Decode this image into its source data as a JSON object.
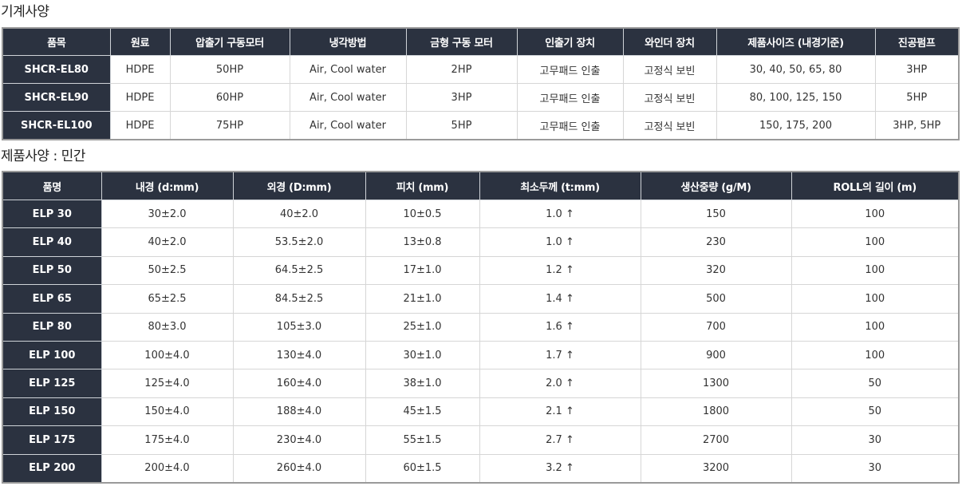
{
  "machine_spec": {
    "title": "기계사양",
    "headers": [
      "품목",
      "원료",
      "압출기 구동모터",
      "냉각방법",
      "금형 구동 모터",
      "인출기 장치",
      "와인더 장치",
      "제품사이즈 (내경기준)",
      "진공펌프"
    ],
    "rows": [
      [
        "SHCR-EL80",
        "HDPE",
        "50HP",
        "Air, Cool water",
        "2HP",
        "고무패드 인출",
        "고정식 보빈",
        "30, 40, 50, 65, 80",
        "3HP"
      ],
      [
        "SHCR-EL90",
        "HDPE",
        "60HP",
        "Air, Cool water",
        "3HP",
        "고무패드 인출",
        "고정식 보빈",
        "80, 100, 125, 150",
        "5HP"
      ],
      [
        "SHCR-EL100",
        "HDPE",
        "75HP",
        "Air, Cool water",
        "5HP",
        "고무패드 인출",
        "고정식 보빈",
        "150, 175, 200",
        "3HP, 5HP"
      ]
    ]
  },
  "product_spec": {
    "title": "제품사양 : 민간",
    "headers": [
      "품명",
      "내경 (d:mm)",
      "외경 (D:mm)",
      "피치 (mm)",
      "최소두께 (t:mm)",
      "생산중량 (g/M)",
      "ROLL의 길이 (m)"
    ],
    "rows": [
      [
        "ELP 30",
        "30±2.0",
        "40±2.0",
        "10±0.5",
        "1.0 ↑",
        "150",
        "100"
      ],
      [
        "ELP 40",
        "40±2.0",
        "53.5±2.0",
        "13±0.8",
        "1.0 ↑",
        "230",
        "100"
      ],
      [
        "ELP 50",
        "50±2.5",
        "64.5±2.5",
        "17±1.0",
        "1.2 ↑",
        "320",
        "100"
      ],
      [
        "ELP 65",
        "65±2.5",
        "84.5±2.5",
        "21±1.0",
        "1.4 ↑",
        "500",
        "100"
      ],
      [
        "ELP 80",
        "80±3.0",
        "105±3.0",
        "25±1.0",
        "1.6 ↑",
        "700",
        "100"
      ],
      [
        "ELP 100",
        "100±4.0",
        "130±4.0",
        "30±1.0",
        "1.7 ↑",
        "900",
        "100"
      ],
      [
        "ELP 125",
        "125±4.0",
        "160±4.0",
        "38±1.0",
        "2.0 ↑",
        "1300",
        "50"
      ],
      [
        "ELP 150",
        "150±4.0",
        "188±4.0",
        "45±1.5",
        "2.1 ↑",
        "1800",
        "50"
      ],
      [
        "ELP 175",
        "175±4.0",
        "230±4.0",
        "55±1.5",
        "2.7 ↑",
        "2700",
        "30"
      ],
      [
        "ELP 200",
        "200±4.0",
        "260±4.0",
        "60±1.5",
        "3.2 ↑",
        "3200",
        "30"
      ]
    ]
  },
  "colors": {
    "header_bg": "#2b3240",
    "header_text": "#ffffff",
    "body_text": "#333333",
    "border": "#d6d6d6"
  }
}
